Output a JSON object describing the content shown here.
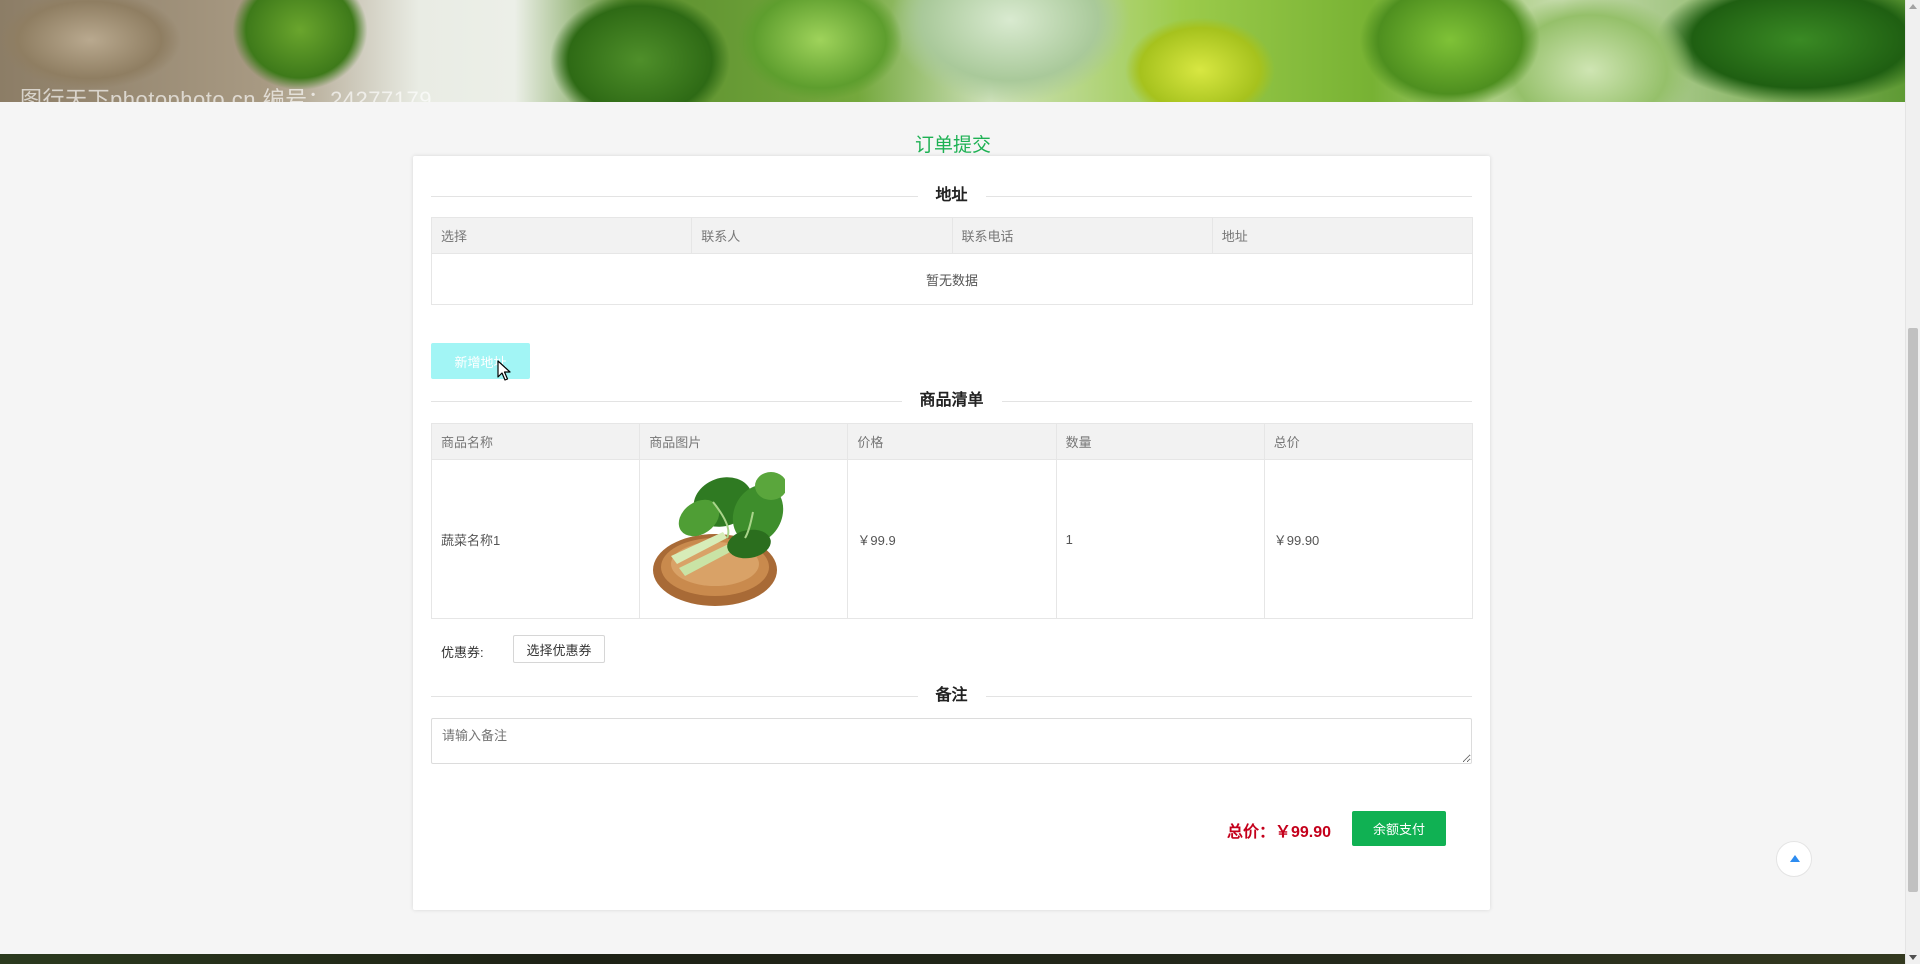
{
  "banner": {
    "watermark": "图行天下photophoto.cn  编号：24277179"
  },
  "page": {
    "title": "订单提交"
  },
  "address_section": {
    "title": "地址",
    "columns": [
      "选择",
      "联系人",
      "联系电话",
      "地址"
    ],
    "empty_text": "暂无数据",
    "add_button": "新增地址"
  },
  "goods_section": {
    "title": "商品清单",
    "columns": [
      "商品名称",
      "商品图片",
      "价格",
      "数量",
      "总价"
    ],
    "rows": [
      {
        "name": "蔬菜名称1",
        "price": "￥99.9",
        "quantity": "1",
        "total": "￥99.90"
      }
    ]
  },
  "coupon": {
    "label": "优惠券:",
    "button": "选择优惠券"
  },
  "remark_section": {
    "title": "备注",
    "placeholder": "请输入备注"
  },
  "summary": {
    "total_text": "总价：￥99.90",
    "pay_button": "余额支付"
  },
  "colors": {
    "accent_green": "#10b153",
    "title_green": "#1db153",
    "price_red": "#c4001b",
    "add_button_cyan": "#a2f5f5"
  }
}
